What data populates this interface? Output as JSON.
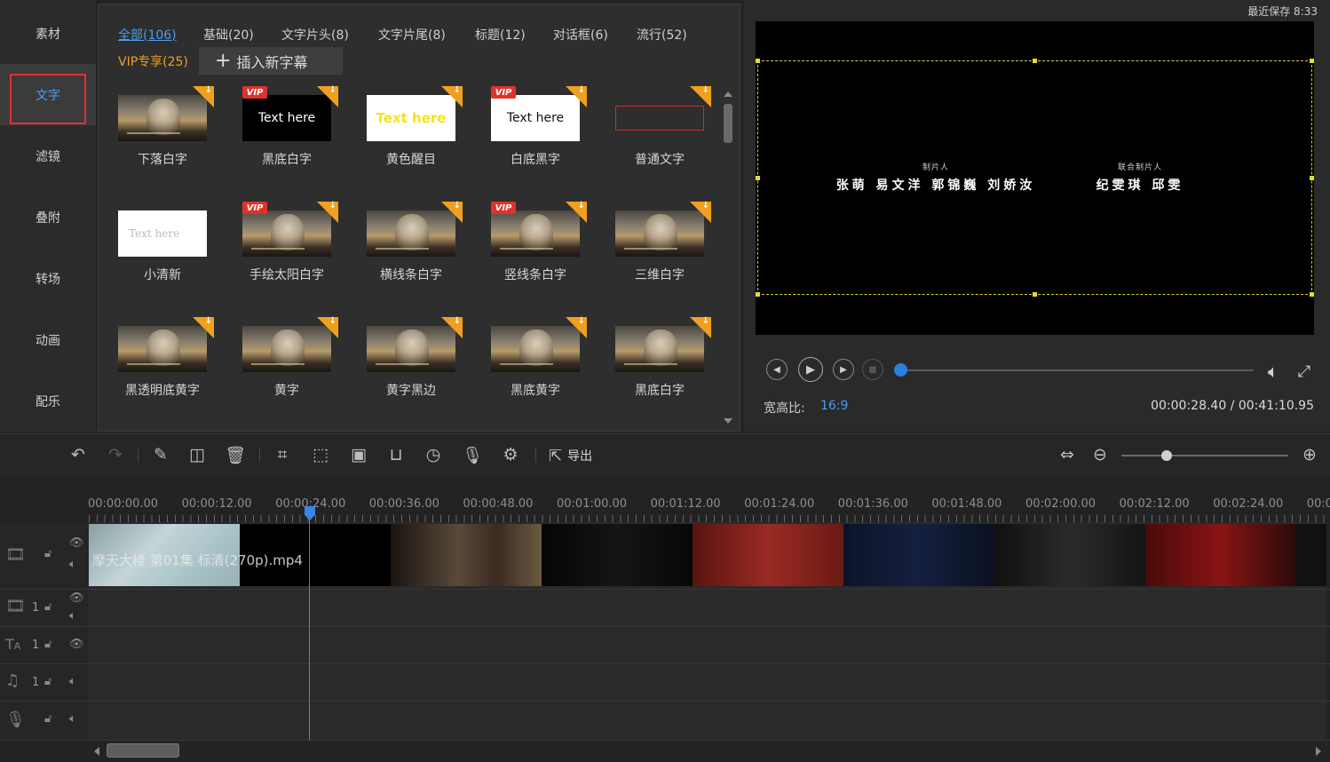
{
  "sidebar": {
    "items": [
      {
        "label": "素材"
      },
      {
        "label": "文字",
        "active": true
      },
      {
        "label": "滤镜"
      },
      {
        "label": "叠附"
      },
      {
        "label": "转场"
      },
      {
        "label": "动画"
      },
      {
        "label": "配乐"
      }
    ]
  },
  "library": {
    "tabs": [
      {
        "label": "全部(106)",
        "active": true
      },
      {
        "label": "基础(20)"
      },
      {
        "label": "文字片头(8)"
      },
      {
        "label": "文字片尾(8)"
      },
      {
        "label": "标题(12)"
      },
      {
        "label": "对话框(6)"
      },
      {
        "label": "流行(52)"
      }
    ],
    "vip_tab": "VIP专享(25)",
    "insert_button": "插入新字幕",
    "tiles": [
      {
        "label": "下落白字",
        "style": "photo",
        "text": "",
        "vip": false
      },
      {
        "label": "黑底白字",
        "style": "black",
        "text": "Text here",
        "vip": true
      },
      {
        "label": "黄色醒目",
        "style": "yellow",
        "text": "Text here",
        "vip": false
      },
      {
        "label": "白底黑字",
        "style": "white",
        "text": "Text here",
        "vip": true
      },
      {
        "label": "普通文字",
        "style": "outline",
        "text": "",
        "vip": false
      },
      {
        "label": "小清新",
        "style": "light",
        "text": "Text here",
        "vip": false,
        "nodl": true
      },
      {
        "label": "手绘太阳白字",
        "style": "photo",
        "text": "",
        "vip": true
      },
      {
        "label": "横线条白字",
        "style": "photo",
        "text": "",
        "vip": false
      },
      {
        "label": "竖线条白字",
        "style": "photo",
        "text": "",
        "vip": true
      },
      {
        "label": "三维白字",
        "style": "photo",
        "text": "",
        "vip": false
      },
      {
        "label": "黑透明底黄字",
        "style": "photo",
        "text": "",
        "vip": false
      },
      {
        "label": "黄字",
        "style": "photo",
        "text": "",
        "vip": false
      },
      {
        "label": "黄字黑边",
        "style": "photo",
        "text": "",
        "vip": false
      },
      {
        "label": "黑底黄字",
        "style": "photo",
        "text": "",
        "vip": false
      },
      {
        "label": "黑底白字",
        "style": "photo",
        "text": "",
        "vip": false
      }
    ],
    "vip_badge": "VIP"
  },
  "preview": {
    "save_status": "最近保存 8:33",
    "credits": [
      {
        "role": "制片人",
        "names": "张萌  易文洋  郭锦巍  刘娇汝"
      },
      {
        "role": "联合制片人",
        "names": "纪雯琪  邱雯"
      }
    ],
    "aspect_label": "宽高比:",
    "aspect_value": "16:9",
    "timecode": "00:00:28.40 / 00:41:10.95",
    "progress": 0.0
  },
  "toolbar": {
    "export_label": "导出",
    "zoom_level": 0.27
  },
  "ruler": {
    "labels": [
      "00:00:00.00",
      "00:00:12.00",
      "00:00:24.00",
      "00:00:36.00",
      "00:00:48.00",
      "00:01:00.00",
      "00:01:12.00",
      "00:01:24.00",
      "00:01:36.00",
      "00:01:48.00",
      "00:02:00.00",
      "00:02:12.00",
      "00:02:24.00",
      "00:0"
    ]
  },
  "tracks": {
    "clip_label": "摩天大楼 第01集 标清(270p).mp4",
    "track_number": "1"
  },
  "colors": {
    "accent": "#4a9df0",
    "vip": "#f0a01e",
    "highlight_border": "#e0322d",
    "playhead": "#3a86e8"
  }
}
